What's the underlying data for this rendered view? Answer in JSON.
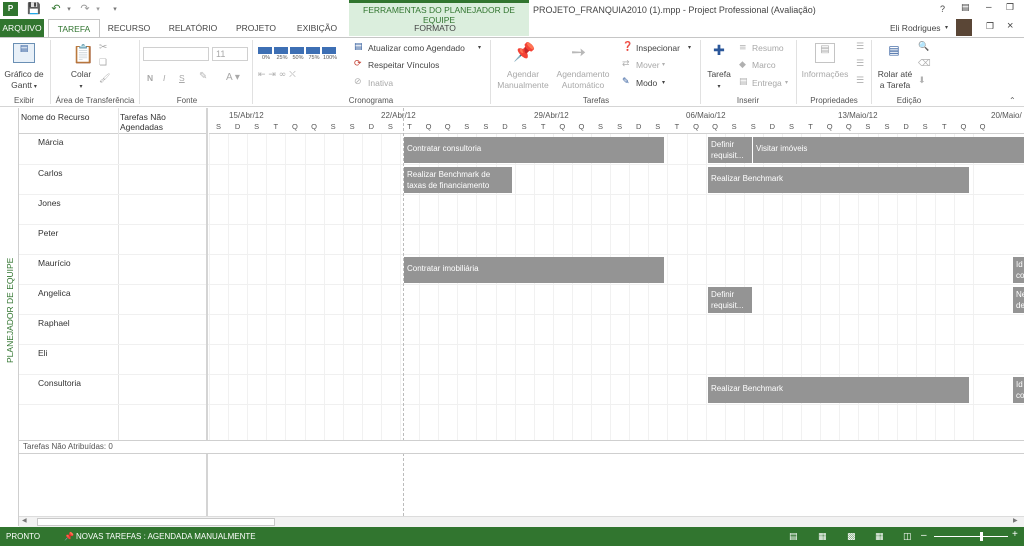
{
  "titlebar": {
    "context_title": "FERRAMENTAS DO PLANEJADOR DE EQUIPE",
    "app_title": "PROJETO_FRANQUIA2010 (1).mpp - Project Professional (Avaliação)",
    "help": "?",
    "user": "Eli Rodrigues"
  },
  "tabs": [
    "ARQUIVO",
    "TAREFA",
    "RECURSO",
    "RELATÓRIO",
    "PROJETO",
    "EXIBIÇÃO",
    "FORMATO"
  ],
  "ribbon": {
    "exibir": {
      "btn": "Gráfico de Gantt",
      "btn1": "Gráfico de",
      "btn2": "Gantt",
      "group": "Exibir"
    },
    "clipboard": {
      "paste": "Colar",
      "group": "Área de Transferência"
    },
    "fonte": {
      "size": "11",
      "bold": "N",
      "italic": "I",
      "underline": "S",
      "group": "Fonte"
    },
    "cronograma": {
      "pcts": [
        "0%",
        "25%",
        "50%",
        "75%",
        "100%"
      ],
      "update": "Atualizar como Agendado",
      "respect": "Respeitar Vínculos",
      "inactive": "Inativa",
      "group": "Cronograma"
    },
    "tarefas": {
      "manual1": "Agendar",
      "manual2": "Manualmente",
      "auto1": "Agendamento",
      "auto2": "Automático",
      "inspect": "Inspecionar",
      "move": "Mover",
      "mode": "Modo",
      "group": "Tarefas"
    },
    "inserir": {
      "task": "Tarefa",
      "summary": "Resumo",
      "milestone": "Marco",
      "deliverable": "Entrega",
      "group": "Inserir"
    },
    "propriedades": {
      "info": "Informações",
      "group": "Propriedades"
    },
    "edicao": {
      "scroll1": "Rolar até",
      "scroll2": "a Tarefa",
      "group": "Edição"
    }
  },
  "view_name": "PLANEJADOR DE EQUIPE",
  "columns": {
    "name": "Nome do Recurso",
    "unsched1": "Tarefas Não",
    "unsched2": "Agendadas"
  },
  "timeline": {
    "weeks": [
      "15/Abr/12",
      "22/Abr/12",
      "29/Abr/12",
      "06/Maio/12",
      "13/Maio/12",
      "20/Maio/"
    ],
    "days": [
      "S",
      "D",
      "S",
      "T",
      "Q",
      "Q",
      "S",
      "S",
      "D",
      "S",
      "T",
      "Q",
      "Q",
      "S",
      "S",
      "D",
      "S",
      "T",
      "Q",
      "Q",
      "S",
      "S",
      "D",
      "S",
      "T",
      "Q",
      "Q",
      "S",
      "S",
      "D",
      "S",
      "T",
      "Q",
      "Q",
      "S",
      "S",
      "D",
      "S",
      "T",
      "Q",
      "Q"
    ]
  },
  "resources": [
    "Márcia",
    "Carlos",
    "Jones",
    "Peter",
    "Maurício",
    "Angelica",
    "Raphael",
    "Eli",
    "Consultoria"
  ],
  "bars": {
    "b1": "Contratar consultoria",
    "b2": "Definir requisit...",
    "b3": "Visitar imóveis",
    "b4": "Realizar Benchmark de taxas de financiamento",
    "b5": "Realizar Benchmark",
    "b6": "Contratar imobiliária",
    "b7": "Id co",
    "b8": "Definir requisit...",
    "b9": "Ne de",
    "b10": "Realizar Benchmark",
    "b11": "Id co"
  },
  "unassigned": "Tarefas Não Atribuídas: 0",
  "status": {
    "ready": "PRONTO",
    "newtasks": "NOVAS TAREFAS : AGENDADA MANUALMENTE"
  },
  "colors": {
    "accent": "#31752f",
    "bar": "#949494",
    "context_bg": "#dbeedd"
  }
}
